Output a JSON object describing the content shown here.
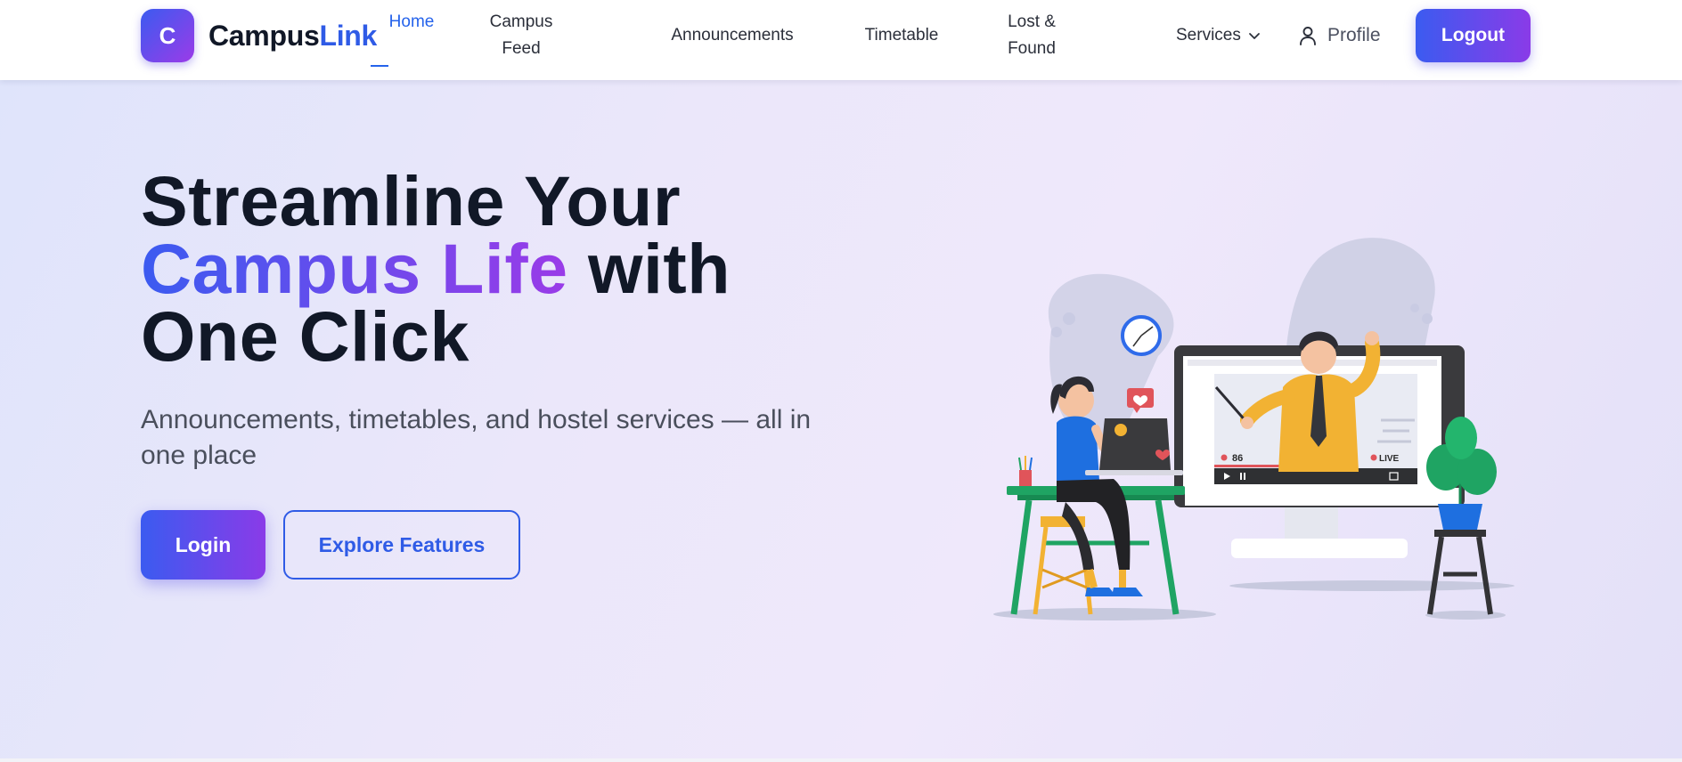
{
  "brand": {
    "logo_letter": "C",
    "name_main": "Campus",
    "name_accent": "Link"
  },
  "nav": {
    "items": [
      {
        "label": "Home"
      },
      {
        "label": "Campus Feed"
      },
      {
        "label": "Announcements"
      },
      {
        "label": "Timetable"
      },
      {
        "label": "Lost & Found"
      }
    ],
    "services_label": "Services",
    "profile_label": "Profile",
    "logout_label": "Logout"
  },
  "hero": {
    "headline_line1": "Streamline Your",
    "headline_accent": "Campus Life",
    "headline_after_accent": " with",
    "headline_line3": "One Click",
    "subtitle": "Announcements, timetables, and hostel services — all in one place",
    "login_label": "Login",
    "explore_label": "Explore Features"
  },
  "illustration": {
    "viewer_count": "86",
    "live_label": "LIVE"
  },
  "colors": {
    "primary": "#3b5bf0",
    "secondary": "#8a3be8",
    "link_blue": "#2563eb",
    "heading": "#111827"
  },
  "icons": [
    "chevron-down-icon",
    "user-icon"
  ]
}
